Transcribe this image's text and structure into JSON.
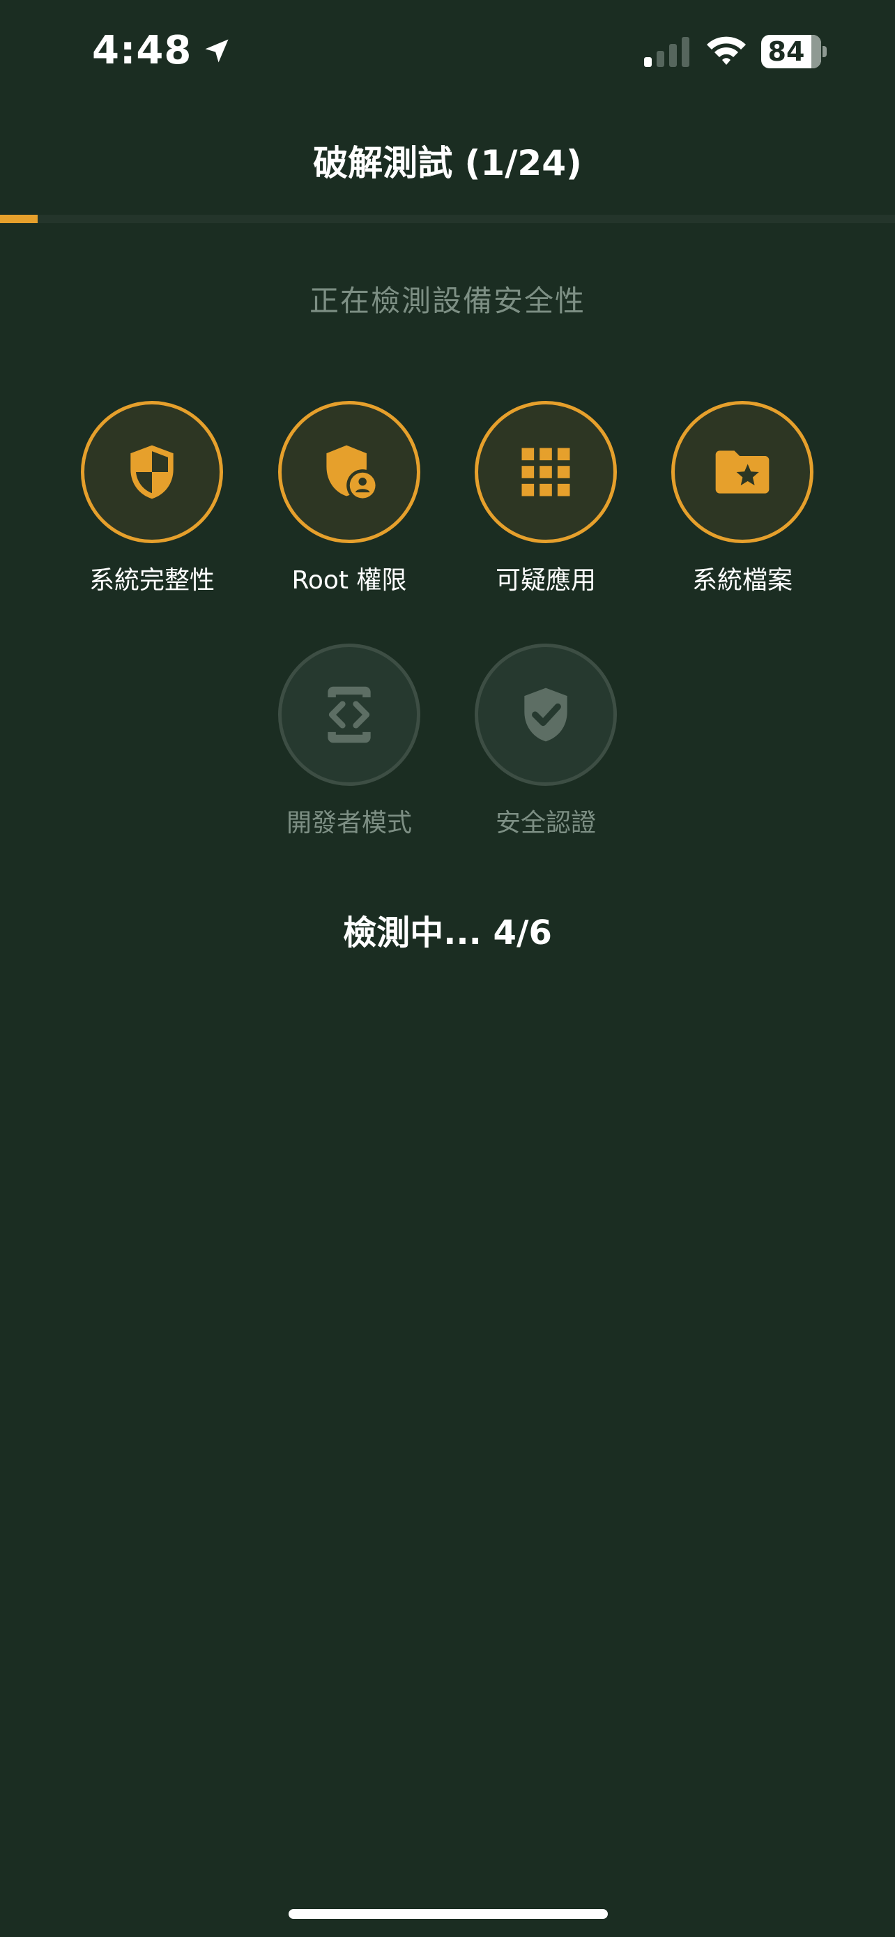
{
  "status_bar": {
    "time": "4:48",
    "battery": "84",
    "battery_percent": 84,
    "icons": [
      "location-arrow-icon",
      "cellular-signal-icon",
      "wifi-icon",
      "battery-icon"
    ]
  },
  "header": {
    "title": "破解測試 (1/24)"
  },
  "progress": {
    "current": 1,
    "total": 24,
    "fraction": 0.0417,
    "color": "#e6a02c"
  },
  "subtitle": "正在檢測設備安全性",
  "checks": [
    {
      "label": "系統完整性",
      "icon": "shield-half-icon",
      "state": "active"
    },
    {
      "label": "Root 權限",
      "icon": "shield-user-icon",
      "state": "active"
    },
    {
      "label": "可疑應用",
      "icon": "app-grid-icon",
      "state": "active"
    },
    {
      "label": "系統檔案",
      "icon": "folder-star-icon",
      "state": "active"
    },
    {
      "label": "開發者模式",
      "icon": "code-device-icon",
      "state": "pending"
    },
    {
      "label": "安全認證",
      "icon": "shield-check-icon",
      "state": "pending"
    }
  ],
  "scan_status": "檢測中... 4/6",
  "colors": {
    "background": "#1b2d22",
    "accent": "#e6a02c",
    "inactive": "#3d4e44",
    "muted_text": "#7d8f84"
  }
}
